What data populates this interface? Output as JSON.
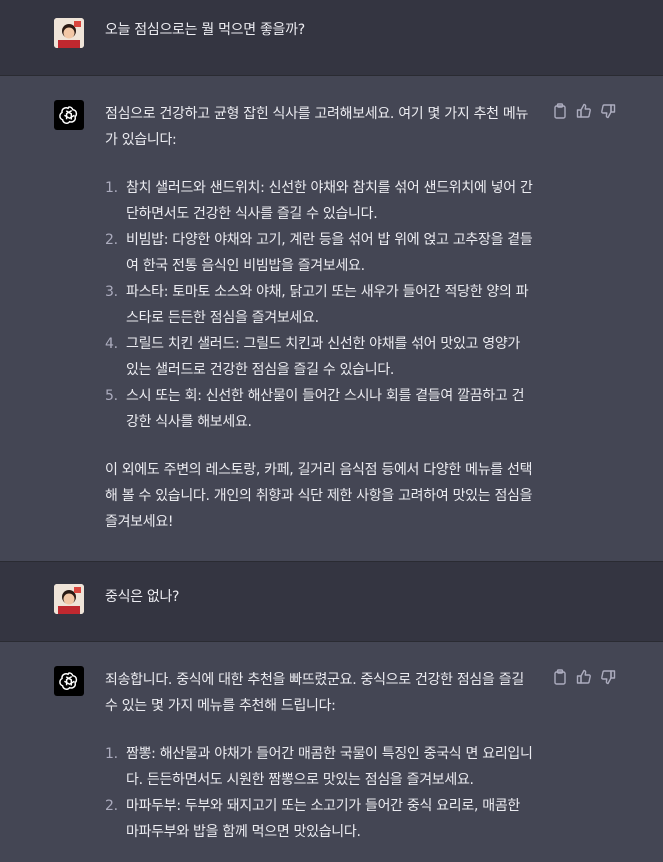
{
  "conversation": {
    "user_message_1": "오늘 점심으로는 뭘 먹으면 좋을까?",
    "bot_message_1": {
      "intro": "점심으로 건강하고 균형 잡힌 식사를 고려해보세요. 여기 몇 가지 추천 메뉴가 있습니다:",
      "items": [
        {
          "num": "1.",
          "text": "참치 샐러드와 샌드위치: 신선한 야채와 참치를 섞어 샌드위치에 넣어 간단하면서도 건강한 식사를 즐길 수 있습니다."
        },
        {
          "num": "2.",
          "text": "비빔밥: 다양한 야채와 고기, 계란 등을 섞어 밥 위에 얹고 고추장을 곁들여 한국 전통 음식인 비빔밥을 즐겨보세요."
        },
        {
          "num": "3.",
          "text": "파스타: 토마토 소스와 야채, 닭고기 또는 새우가 들어간 적당한 양의 파스타로 든든한 점심을 즐겨보세요."
        },
        {
          "num": "4.",
          "text": "그릴드 치킨 샐러드: 그릴드 치킨과 신선한 야채를 섞어 맛있고 영양가 있는 샐러드로 건강한 점심을 즐길 수 있습니다."
        },
        {
          "num": "5.",
          "text": "스시 또는 회: 신선한 해산물이 들어간 스시나 회를 곁들여 깔끔하고 건강한 식사를 해보세요."
        }
      ],
      "outro": "이 외에도 주변의 레스토랑, 카페, 길거리 음식점 등에서 다양한 메뉴를 선택해 볼 수 있습니다. 개인의 취향과 식단 제한 사항을 고려하여 맛있는 점심을 즐겨보세요!"
    },
    "user_message_2": "중식은 없나?",
    "bot_message_2": {
      "intro": "죄송합니다. 중식에 대한 추천을 빠뜨렸군요. 중식으로 건강한 점심을 즐길 수 있는 몇 가지 메뉴를 추천해 드립니다:",
      "items": [
        {
          "num": "1.",
          "text": "짬뽕: 해산물과 야채가 들어간 매콤한 국물이 특징인 중국식 면 요리입니다. 든든하면서도 시원한 짬뽕으로 맛있는 점심을 즐겨보세요."
        },
        {
          "num": "2.",
          "text": "마파두부: 두부와 돼지고기 또는 소고기가 들어간 중식 요리로, 매콤한 마파두부와 밥을 함께 먹으면 맛있습니다."
        }
      ]
    }
  },
  "icons": [
    "user-avatar",
    "chatgpt-logo-icon",
    "copy-icon",
    "thumbs-up-icon",
    "thumbs-down-icon"
  ],
  "colors": {
    "user_bg": "#343541",
    "bot_bg": "#444654",
    "text": "#ececf1",
    "icon": "#acacbe"
  }
}
